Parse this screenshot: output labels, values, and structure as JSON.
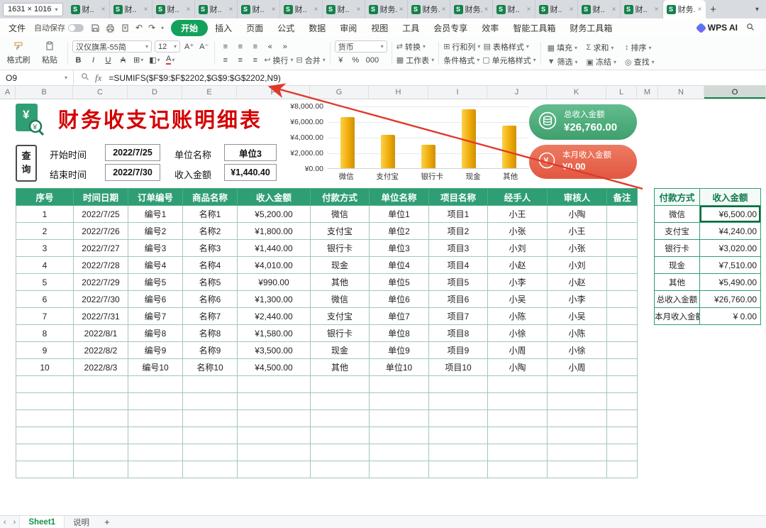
{
  "window": {
    "size_indicator": "1631 × 1016",
    "tab_icon": "S",
    "tabs": [
      "财..",
      "财..",
      "财..",
      "财..",
      "财..",
      "财..",
      "财..",
      "财务..",
      "财务..",
      "财务..",
      "财..",
      "财..",
      "财..",
      "财..",
      "财务.."
    ],
    "active_index": 14,
    "new_tab": "+"
  },
  "menu": {
    "file": "文件",
    "autosave_label": "自动保存",
    "tabs": [
      "开始",
      "插入",
      "页面",
      "公式",
      "数据",
      "审阅",
      "视图",
      "工具",
      "会员专享",
      "效率",
      "智能工具箱",
      "财务工具箱"
    ],
    "active_tab": "开始",
    "wps_ai": "WPS AI"
  },
  "toolbar": {
    "format_painter": "格式刷",
    "paste": "粘贴",
    "font_name": "汉仪旗黑-55简",
    "font_size": "12",
    "wrap": "换行",
    "merge": "合并",
    "number_format": "货币",
    "convert": "转换",
    "rows_cols": "行和列",
    "worksheet": "工作表",
    "conditional_format": "条件格式",
    "table_style": "表格样式",
    "cell_style": "单元格样式",
    "quick_actions": [
      {
        "label": "填充",
        "icon": "▦"
      },
      {
        "label": "求和",
        "icon": "Σ"
      },
      {
        "label": "排序",
        "icon": "↕"
      },
      {
        "label": "筛选",
        "icon": "▼"
      },
      {
        "label": "冻结",
        "icon": "▣"
      },
      {
        "label": "查找",
        "icon": "◎"
      }
    ]
  },
  "formula_bar": {
    "cell_ref": "O9",
    "fx": "fx",
    "formula": "=SUMIFS($F$9:$F$2202,$G$9:$G$2202,N9)"
  },
  "grid": {
    "columns": [
      "A",
      "B",
      "C",
      "D",
      "E",
      "F",
      "G",
      "H",
      "I",
      "J",
      "K",
      "L",
      "M",
      "N",
      "O"
    ],
    "selected_column": "O"
  },
  "sheet": {
    "title": "财务收支记账明细表",
    "query_button": "查询",
    "filters": {
      "start_label": "开始时间",
      "start_value": "2022/7/25",
      "end_label": "结束时间",
      "end_value": "2022/7/30",
      "unit_label": "单位名称",
      "unit_value": "单位3",
      "amount_label": "收入金额",
      "amount_value": "¥1,440.40"
    },
    "total_badge": {
      "label": "总收入金额",
      "value": "¥26,760.00"
    },
    "month_badge": {
      "label": "本月收入金额",
      "value": "¥0.00"
    }
  },
  "chart_data": {
    "type": "bar",
    "categories": [
      "微信",
      "支付宝",
      "银行卡",
      "现金",
      "其他"
    ],
    "values": [
      6500,
      4240,
      3020,
      7510,
      5490
    ],
    "title": "",
    "xlabel": "",
    "ylabel": "",
    "ylim": [
      0,
      8000
    ],
    "ytick_labels": [
      "¥8,000.00",
      "¥6,000.00",
      "¥4,000.00",
      "¥2,000.00",
      "¥0.00"
    ],
    "bar_color": "#F0AB0A",
    "grid": true,
    "legend": false
  },
  "main_table": {
    "headers": [
      "序号",
      "时间日期",
      "订单编号",
      "商品名称",
      "收入金额",
      "付款方式",
      "单位名称",
      "项目名称",
      "经手人",
      "审核人",
      "备注"
    ],
    "rows": [
      [
        "1",
        "2022/7/25",
        "编号1",
        "名称1",
        "¥5,200.00",
        "微信",
        "单位1",
        "项目1",
        "小王",
        "小陶",
        ""
      ],
      [
        "2",
        "2022/7/26",
        "编号2",
        "名称2",
        "¥1,800.00",
        "支付宝",
        "单位2",
        "项目2",
        "小张",
        "小王",
        ""
      ],
      [
        "3",
        "2022/7/27",
        "编号3",
        "名称3",
        "¥1,440.00",
        "银行卡",
        "单位3",
        "项目3",
        "小刘",
        "小张",
        ""
      ],
      [
        "4",
        "2022/7/28",
        "编号4",
        "名称4",
        "¥4,010.00",
        "现金",
        "单位4",
        "项目4",
        "小赵",
        "小刘",
        ""
      ],
      [
        "5",
        "2022/7/29",
        "编号5",
        "名称5",
        "¥990.00",
        "其他",
        "单位5",
        "项目5",
        "小李",
        "小赵",
        ""
      ],
      [
        "6",
        "2022/7/30",
        "编号6",
        "名称6",
        "¥1,300.00",
        "微信",
        "单位6",
        "项目6",
        "小吴",
        "小李",
        ""
      ],
      [
        "7",
        "2022/7/31",
        "编号7",
        "名称7",
        "¥2,440.00",
        "支付宝",
        "单位7",
        "项目7",
        "小陈",
        "小吴",
        ""
      ],
      [
        "8",
        "2022/8/1",
        "编号8",
        "名称8",
        "¥1,580.00",
        "银行卡",
        "单位8",
        "项目8",
        "小徐",
        "小陈",
        ""
      ],
      [
        "9",
        "2022/8/2",
        "编号9",
        "名称9",
        "¥3,500.00",
        "现金",
        "单位9",
        "项目9",
        "小周",
        "小徐",
        ""
      ],
      [
        "10",
        "2022/8/3",
        "编号10",
        "名称10",
        "¥4,500.00",
        "其他",
        "单位10",
        "项目10",
        "小陶",
        "小周",
        ""
      ]
    ],
    "empty_row_count": 6
  },
  "summary_table": {
    "headers": [
      "付款方式",
      "收入金额"
    ],
    "rows": [
      [
        "微信",
        "¥6,500.00"
      ],
      [
        "支付宝",
        "¥4,240.00"
      ],
      [
        "银行卡",
        "¥3,020.00"
      ],
      [
        "现金",
        "¥7,510.00"
      ],
      [
        "其他",
        "¥5,490.00"
      ],
      [
        "总收入金额",
        "¥26,760.00"
      ],
      [
        "本月收入金额",
        "¥ 0.00"
      ]
    ],
    "selected": {
      "row": 0,
      "col": 1
    }
  },
  "sheet_bar": {
    "tabs": [
      "Sheet1",
      "说明"
    ],
    "active": "Sheet1",
    "add": "+"
  }
}
